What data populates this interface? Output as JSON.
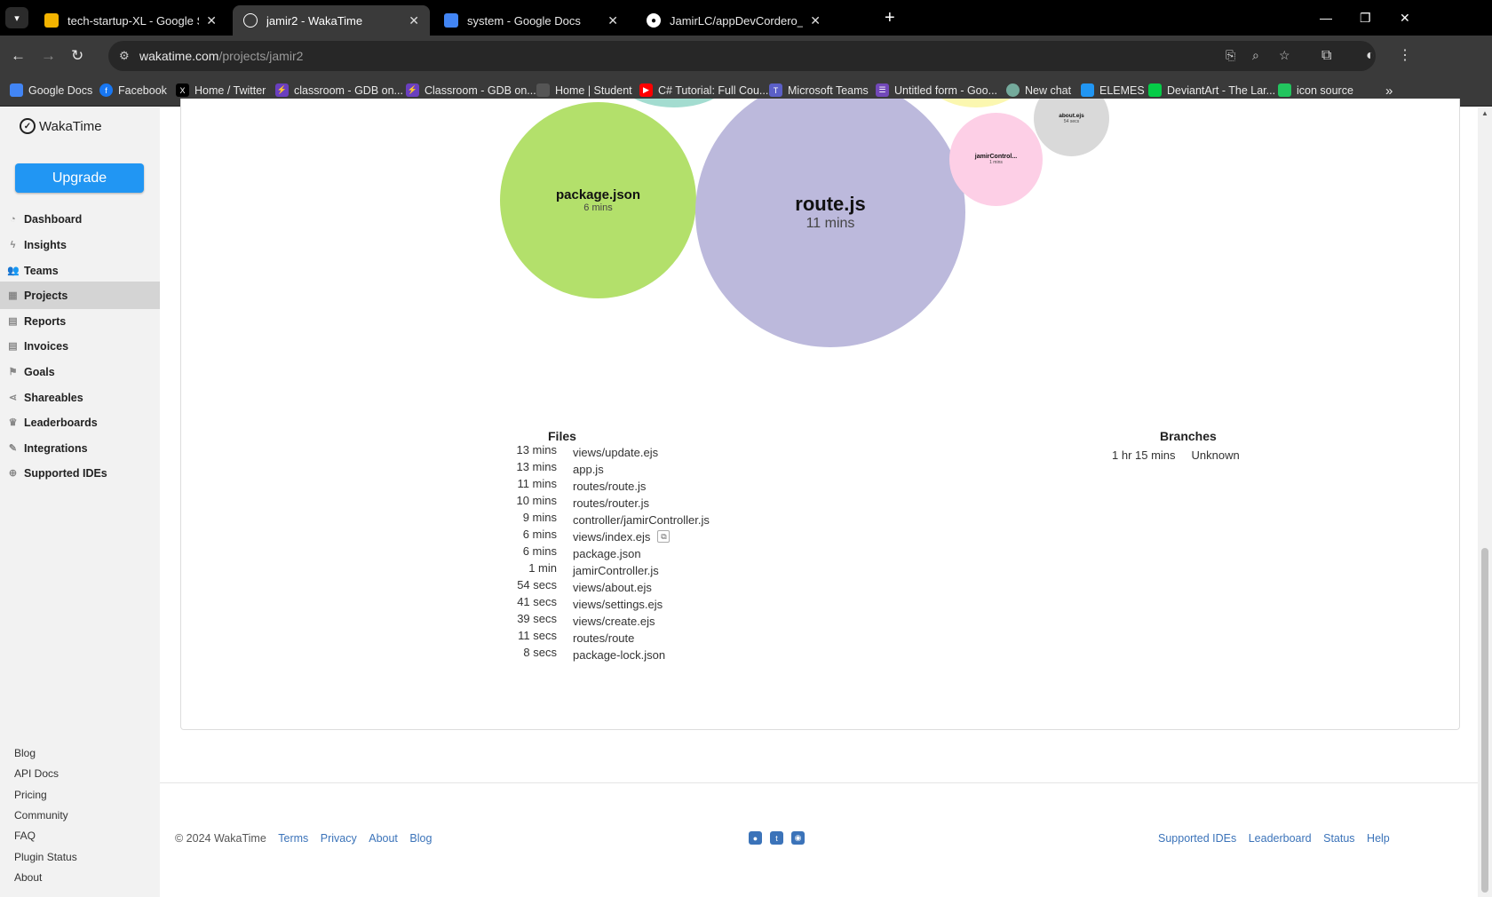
{
  "browser": {
    "tabs": [
      {
        "title": "tech-startup-XL - Google Slides",
        "icon": "google-slides-icon",
        "color": "#f4b400",
        "active": false
      },
      {
        "title": "jamir2 - WakaTime",
        "icon": "wakatime-icon",
        "color": "#3a3a3a",
        "active": true
      },
      {
        "title": "system - Google Docs",
        "icon": "google-docs-icon",
        "color": "#4285f4",
        "active": false
      },
      {
        "title": "JamirLC/appDevCordero_simple",
        "icon": "github-icon",
        "color": "#000000",
        "active": false
      }
    ],
    "url_host": "wakatime.com",
    "url_path": "/projects/jamir2",
    "bookmarks": [
      {
        "label": "Google Docs",
        "icon": "google-docs-icon",
        "color": "#4285f4"
      },
      {
        "label": "Facebook",
        "icon": "facebook-icon",
        "color": "#1877f2"
      },
      {
        "label": "Home / Twitter",
        "icon": "x-icon",
        "color": "#000000"
      },
      {
        "label": "classroom - GDB on...",
        "icon": "gdb-icon",
        "color": "#6a3fbf"
      },
      {
        "label": "Classroom - GDB on...",
        "icon": "gdb-icon",
        "color": "#6a3fbf"
      },
      {
        "label": "Home | Student",
        "icon": "student-icon",
        "color": "#555555"
      },
      {
        "label": "C# Tutorial: Full Cou...",
        "icon": "youtube-icon",
        "color": "#ff0000"
      },
      {
        "label": "Microsoft Teams",
        "icon": "teams-icon",
        "color": "#5b5fc7"
      },
      {
        "label": "Untitled form - Goo...",
        "icon": "google-forms-icon",
        "color": "#7248b9"
      },
      {
        "label": "New chat",
        "icon": "chatgpt-icon",
        "color": "#74aa9c"
      },
      {
        "label": "ELEMES",
        "icon": "elemes-icon",
        "color": "#2196f3"
      },
      {
        "label": "DeviantArt - The Lar...",
        "icon": "deviantart-icon",
        "color": "#05cc47"
      },
      {
        "label": "icon source",
        "icon": "icon-source-icon",
        "color": "#22c55e"
      }
    ]
  },
  "sidebar": {
    "brand": "WakaTime",
    "upgrade_label": "Upgrade",
    "upgrade_color": "#2196f3",
    "items": [
      {
        "label": "Dashboard",
        "icon": "dashboard-icon",
        "active": false
      },
      {
        "label": "Insights",
        "icon": "bolt-icon",
        "active": false
      },
      {
        "label": "Teams",
        "icon": "users-icon",
        "active": false
      },
      {
        "label": "Projects",
        "icon": "grid-icon",
        "active": true
      },
      {
        "label": "Reports",
        "icon": "document-icon",
        "active": false
      },
      {
        "label": "Invoices",
        "icon": "invoice-icon",
        "active": false
      },
      {
        "label": "Goals",
        "icon": "flag-icon",
        "active": false
      },
      {
        "label": "Shareables",
        "icon": "share-icon",
        "active": false
      },
      {
        "label": "Leaderboards",
        "icon": "trophy-icon",
        "active": false
      },
      {
        "label": "Integrations",
        "icon": "wrench-icon",
        "active": false
      },
      {
        "label": "Supported IDEs",
        "icon": "plus-circle-icon",
        "active": false
      }
    ],
    "footer_links": [
      "Blog",
      "API Docs",
      "Pricing",
      "Community",
      "FAQ",
      "Plugin Status",
      "About"
    ]
  },
  "bubbles": [
    {
      "name": "package.json",
      "time": "6 mins",
      "color": "#b3e06b"
    },
    {
      "name": "route.js",
      "time": "11 mins",
      "color": "#bcb9dc"
    },
    {
      "name": "jamirControl...",
      "time": "1 mins",
      "color": "#fdcfe6"
    },
    {
      "name": "about.ejs",
      "time": "54 secs",
      "color": "#d9d9d9"
    }
  ],
  "files": {
    "heading": "Files",
    "rows": [
      {
        "time": "13 mins",
        "name": "views/update.ejs"
      },
      {
        "time": "13 mins",
        "name": "app.js"
      },
      {
        "time": "11 mins",
        "name": "routes/route.js"
      },
      {
        "time": "10 mins",
        "name": "routes/router.js"
      },
      {
        "time": "9 mins",
        "name": "controller/jamirController.js"
      },
      {
        "time": "6 mins",
        "name": "views/index.ejs",
        "copy": true
      },
      {
        "time": "6 mins",
        "name": "package.json"
      },
      {
        "time": "1 min",
        "name": "jamirController.js"
      },
      {
        "time": "54 secs",
        "name": "views/about.ejs"
      },
      {
        "time": "41 secs",
        "name": "views/settings.ejs"
      },
      {
        "time": "39 secs",
        "name": "views/create.ejs"
      },
      {
        "time": "11 secs",
        "name": "routes/route"
      },
      {
        "time": "8 secs",
        "name": "package-lock.json"
      }
    ]
  },
  "branches": {
    "heading": "Branches",
    "rows": [
      {
        "time": "1 hr 15 mins",
        "name": "Unknown"
      }
    ]
  },
  "footer": {
    "copyright": "© 2024 WakaTime",
    "left_links": [
      "Terms",
      "Privacy",
      "About",
      "Blog"
    ],
    "right_links": [
      "Supported IDEs",
      "Leaderboard",
      "Status",
      "Help"
    ],
    "social": [
      "github-icon",
      "twitter-icon",
      "reddit-icon"
    ]
  }
}
